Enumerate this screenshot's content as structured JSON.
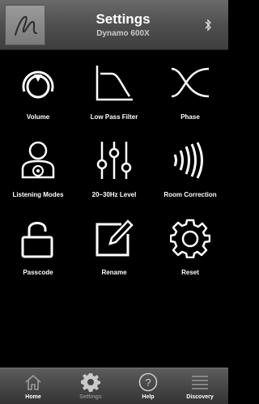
{
  "header": {
    "title": "Settings",
    "subtitle": "Dynamo 600X",
    "logo_icon": "signature-logo-icon",
    "bluetooth_icon": "bluetooth-icon"
  },
  "settings_items": [
    {
      "label": "Volume",
      "icon": "volume-dial-icon"
    },
    {
      "label": "Low Pass Filter",
      "icon": "low-pass-filter-icon"
    },
    {
      "label": "Phase",
      "icon": "phase-icon"
    },
    {
      "label": "Listening Modes",
      "icon": "listening-modes-icon"
    },
    {
      "label": "20–30Hz Level",
      "icon": "level-sliders-icon"
    },
    {
      "label": "Room Correction",
      "icon": "room-correction-icon"
    },
    {
      "label": "Passcode",
      "icon": "padlock-icon"
    },
    {
      "label": "Rename",
      "icon": "rename-pencil-icon"
    },
    {
      "label": "Reset",
      "icon": "reset-gear-icon"
    }
  ],
  "tabs": [
    {
      "label": "Home",
      "icon": "home-icon",
      "active": false
    },
    {
      "label": "Settings",
      "icon": "settings-gear-icon",
      "active": true
    },
    {
      "label": "Help",
      "icon": "help-icon",
      "active": false
    },
    {
      "label": "Discovery",
      "icon": "discovery-list-icon",
      "active": false
    }
  ],
  "colors": {
    "icon": "#ffffff",
    "tab_active": "#8a8a8a",
    "tab_inactive": "#ffffff"
  }
}
